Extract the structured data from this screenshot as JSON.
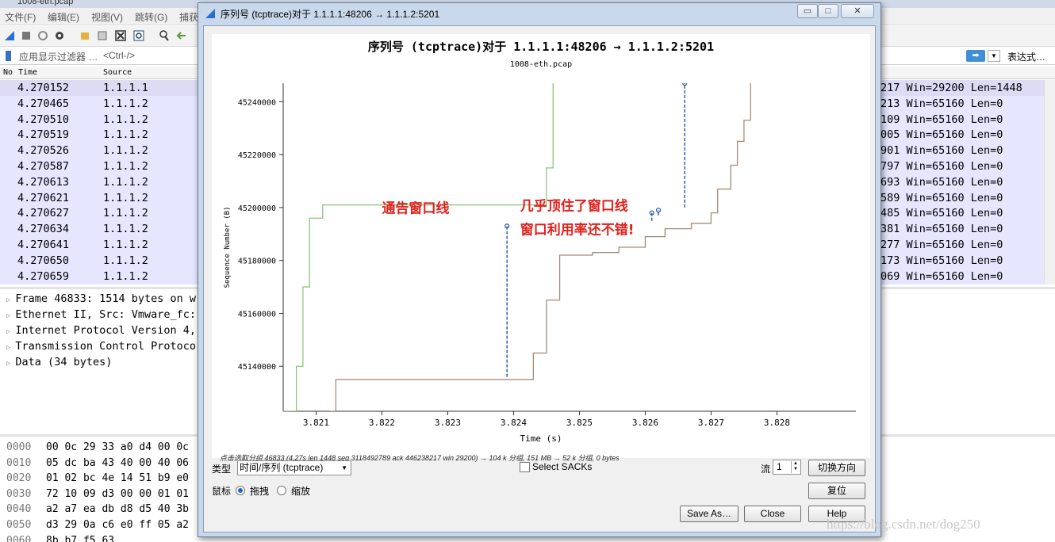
{
  "main_window": {
    "title": "1008-eth.pcap",
    "menu": [
      "文件(F)",
      "编辑(E)",
      "视图(V)",
      "跳转(G)",
      "捕获"
    ],
    "filter": {
      "label": "应用显示过滤器 …",
      "placeholder": "<Ctrl-/>",
      "apply_label": "➡",
      "expression_label": "表达式…"
    },
    "packet_list": {
      "columns": [
        "No",
        "Time",
        "Source"
      ],
      "rows": [
        {
          "time": "4.270152",
          "source": "1.1.1.1",
          "info": "217 Win=29200 Len=1448"
        },
        {
          "time": "4.270465",
          "source": "1.1.1.2",
          "info": "213 Win=65160 Len=0"
        },
        {
          "time": "4.270510",
          "source": "1.1.1.2",
          "info": "109 Win=65160 Len=0"
        },
        {
          "time": "4.270519",
          "source": "1.1.1.2",
          "info": "005 Win=65160 Len=0"
        },
        {
          "time": "4.270526",
          "source": "1.1.1.2",
          "info": "901 Win=65160 Len=0"
        },
        {
          "time": "4.270587",
          "source": "1.1.1.2",
          "info": "797 Win=65160 Len=0"
        },
        {
          "time": "4.270613",
          "source": "1.1.1.2",
          "info": "693 Win=65160 Len=0"
        },
        {
          "time": "4.270621",
          "source": "1.1.1.2",
          "info": "589 Win=65160 Len=0"
        },
        {
          "time": "4.270627",
          "source": "1.1.1.2",
          "info": "485 Win=65160 Len=0"
        },
        {
          "time": "4.270634",
          "source": "1.1.1.2",
          "info": "381 Win=65160 Len=0"
        },
        {
          "time": "4.270641",
          "source": "1.1.1.2",
          "info": "277 Win=65160 Len=0"
        },
        {
          "time": "4.270650",
          "source": "1.1.1.2",
          "info": "173 Win=65160 Len=0"
        },
        {
          "time": "4.270659",
          "source": "1.1.1.2",
          "info": "069 Win=65160 Len=0"
        }
      ]
    },
    "details": [
      "Frame 46833: 1514 bytes on w",
      "Ethernet II, Src: Vmware_fc:",
      "Internet Protocol Version 4,",
      "Transmission Control Protoco",
      "Data (34 bytes)"
    ],
    "bytes": [
      {
        "offset": "0000",
        "hex": "00 0c 29 33 a0 d4 00 0c"
      },
      {
        "offset": "0010",
        "hex": "05 dc ba 43 40 00 40 06"
      },
      {
        "offset": "0020",
        "hex": "01 02 bc 4e 14 51 b9 e0"
      },
      {
        "offset": "0030",
        "hex": "72 10 09 d3 00 00 01 01"
      },
      {
        "offset": "0040",
        "hex": "a2 a7 ea db d8 d5 40 3b"
      },
      {
        "offset": "0050",
        "hex": "d3 29 0a c6 e0 ff 05 a2"
      },
      {
        "offset": "0060",
        "hex": "8b b7 f5 63"
      }
    ]
  },
  "dialog": {
    "window_title": "序列号 (tcptrace)对于 1.1.1.1:48206 → 1.1.1.2:5201",
    "window_buttons": {
      "minimize": "▭",
      "maximize": "□",
      "close": "✕"
    },
    "status_line": "点击选取分组 46833 (4.27s len 1448 seq 3118492789 ack 446238217 win 29200) → 104 k 分组, 151 MB → 52 k 分组, 0 bytes",
    "type_label": "类型",
    "type_value": "时间/序列 (tcptrace)",
    "select_sacks_label": "Select SACKs",
    "stream_label": "流",
    "stream_value": "1",
    "switch_direction_label": "切换方向",
    "mouse_label": "鼠标",
    "mouse_drag_label": "拖拽",
    "mouse_zoom_label": "缩放",
    "mouse_mode": "drag",
    "reset_label": "复位",
    "save_as_label": "Save As…",
    "close_label": "Close",
    "help_label": "Help"
  },
  "chart_data": {
    "type": "line",
    "title": "序列号 (tcptrace)对于 1.1.1.1:48206 → 1.1.1.2:5201",
    "subtitle": "1008-eth.pcap",
    "xlabel": "Time (s)",
    "ylabel": "Sequence Number (B)",
    "xlim": [
      3.8205,
      3.8292
    ],
    "ylim": [
      45123000,
      45247000
    ],
    "x_ticks": [
      3.821,
      3.822,
      3.823,
      3.824,
      3.825,
      3.826,
      3.827,
      3.828
    ],
    "y_ticks": [
      45140000,
      45160000,
      45180000,
      45200000,
      45220000,
      45240000
    ],
    "grid": false,
    "series": [
      {
        "name": "receive window",
        "color": "#8cc57c",
        "points": [
          [
            3.8205,
            45123000
          ],
          [
            3.8207,
            45140000
          ],
          [
            3.8208,
            45170000
          ],
          [
            3.8209,
            45196000
          ],
          [
            3.8211,
            45201000
          ],
          [
            3.8244,
            45201000
          ],
          [
            3.8245,
            45215000
          ],
          [
            3.8246,
            45247000
          ]
        ]
      },
      {
        "name": "ack",
        "color": "#a58c7b",
        "points": [
          [
            3.8212,
            45123000
          ],
          [
            3.8213,
            45135000
          ],
          [
            3.8241,
            45135000
          ],
          [
            3.8243,
            45145000
          ],
          [
            3.8245,
            45165000
          ],
          [
            3.8247,
            45182000
          ],
          [
            3.8252,
            45183000
          ],
          [
            3.8256,
            45185000
          ],
          [
            3.826,
            45189000
          ],
          [
            3.8263,
            45192000
          ],
          [
            3.8267,
            45194000
          ],
          [
            3.827,
            45198000
          ],
          [
            3.8271,
            45207000
          ],
          [
            3.8273,
            45216000
          ],
          [
            3.8274,
            45225000
          ],
          [
            3.8275,
            45233000
          ],
          [
            3.8276,
            45247000
          ]
        ]
      },
      {
        "name": "segments",
        "color": "#2f5fa8",
        "segments": [
          {
            "x": 3.8239,
            "y0": 45136000,
            "y1": 45193000
          },
          {
            "x": 3.8266,
            "y0": 45200000,
            "y1": 45247000
          },
          {
            "x": 3.8261,
            "y0": 45195000,
            "y1": 45198000
          },
          {
            "x": 3.8262,
            "y0": 45197000,
            "y1": 45199000
          }
        ]
      }
    ],
    "annotations": [
      {
        "text": "通告窗口线",
        "x": 3.822,
        "y": 45198000
      },
      {
        "text": "几乎顶住了窗口线",
        "x": 3.8241,
        "y": 45199000
      },
      {
        "text": "窗口利用率还不错!",
        "x": 3.8241,
        "y": 45190000
      }
    ]
  },
  "watermark": "https://blog.csdn.net/dog250"
}
